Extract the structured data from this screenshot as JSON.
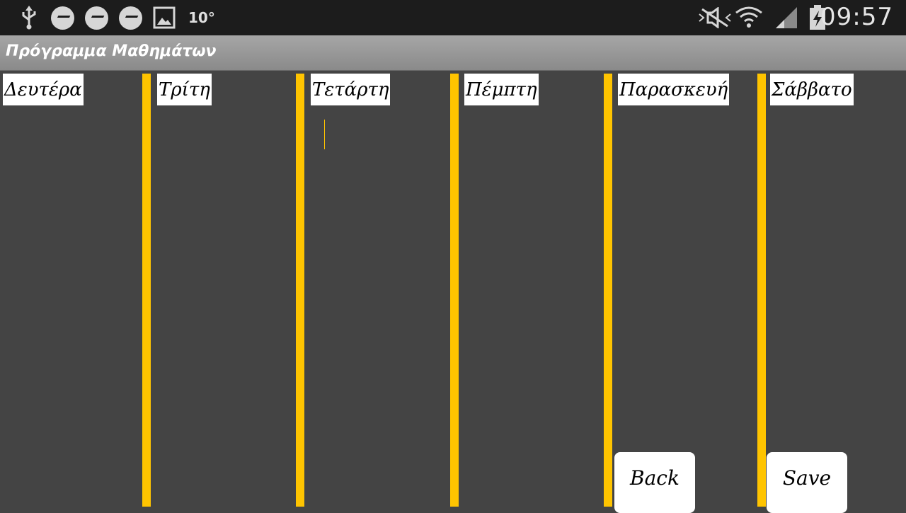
{
  "status_bar": {
    "icons": [
      "usb-icon",
      "messenger-icon",
      "messenger-icon",
      "messenger-icon",
      "gallery-icon"
    ],
    "temperature": "10°",
    "right_icons": [
      "mute-icon",
      "wifi-icon",
      "signal-icon",
      "battery-charging-icon"
    ],
    "time": "09:57"
  },
  "action_bar": {
    "title": "Πρόγραμμα Μαθημάτων"
  },
  "days": [
    "Δευτέρα",
    "Τρίτη",
    "Τετάρτη",
    "Πέμπτη",
    "Παρασκευή",
    "Σάββατο"
  ],
  "buttons": {
    "back": "Back",
    "save": "Save"
  },
  "colors": {
    "background": "#444444",
    "divider": "#ffc400",
    "action_bar": "#9a9a9a",
    "status_bar": "#1c1c1c"
  }
}
